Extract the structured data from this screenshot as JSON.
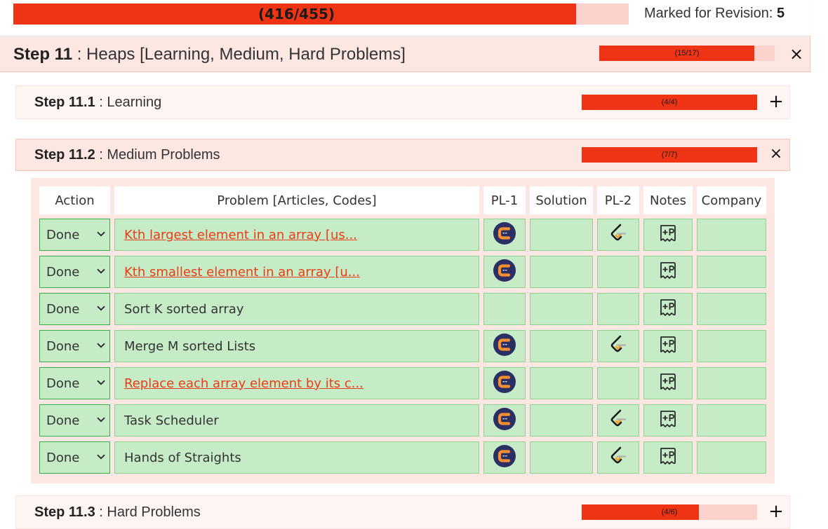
{
  "overall": {
    "progress_text": "(416/455)",
    "progress_fraction": 0.9143,
    "revision_label": "Marked for Revision:",
    "revision_count": "5"
  },
  "step": {
    "num": "Step 11",
    "title": " : Heaps [Learning, Medium, Hard Problems]",
    "progress_text": "(15/17)",
    "progress_fraction": 0.882,
    "toggle": "×"
  },
  "substeps": [
    {
      "num": "Step 11.1",
      "title": " : Learning",
      "progress_text": "(4/4)",
      "progress_fraction": 1.0,
      "toggle": "+"
    },
    {
      "num": "Step 11.2",
      "title": " : Medium Problems",
      "progress_text": "(7/7)",
      "progress_fraction": 1.0,
      "toggle": "×"
    },
    {
      "num": "Step 11.3",
      "title": " : Hard Problems",
      "progress_text": "(4/6)",
      "progress_fraction": 0.667,
      "toggle": "+"
    }
  ],
  "table": {
    "headers": [
      "Action",
      "Problem [Articles, Codes]",
      "PL-1",
      "Solution",
      "PL-2",
      "Notes",
      "Company"
    ],
    "rows": [
      {
        "action": "Done",
        "problem": "Kth largest element in an array [us...",
        "link": true,
        "pl1": true,
        "pl2": true
      },
      {
        "action": "Done",
        "problem": "Kth smallest element in an array [u...",
        "link": true,
        "pl1": true,
        "pl2": false
      },
      {
        "action": "Done",
        "problem": "Sort K sorted array",
        "link": false,
        "pl1": false,
        "pl2": false
      },
      {
        "action": "Done",
        "problem": "Merge M sorted Lists",
        "link": false,
        "pl1": true,
        "pl2": true
      },
      {
        "action": "Done",
        "problem": "Replace each array element by its c...",
        "link": true,
        "pl1": true,
        "pl2": false
      },
      {
        "action": "Done",
        "problem": "Task Scheduler",
        "link": false,
        "pl1": true,
        "pl2": true
      },
      {
        "action": "Done",
        "problem": "Hands of Straights",
        "link": false,
        "pl1": true,
        "pl2": true
      }
    ],
    "icons": {
      "pl1": "codingninjas-icon",
      "pl2": "leetcode-icon",
      "notes": "add-note-icon"
    }
  },
  "colors": {
    "accent": "#ee3414",
    "bar_track": "#fbd3cc",
    "done_cell": "#c6ecc7",
    "done_border": "#34b04a",
    "panel": "#fde7e3"
  }
}
